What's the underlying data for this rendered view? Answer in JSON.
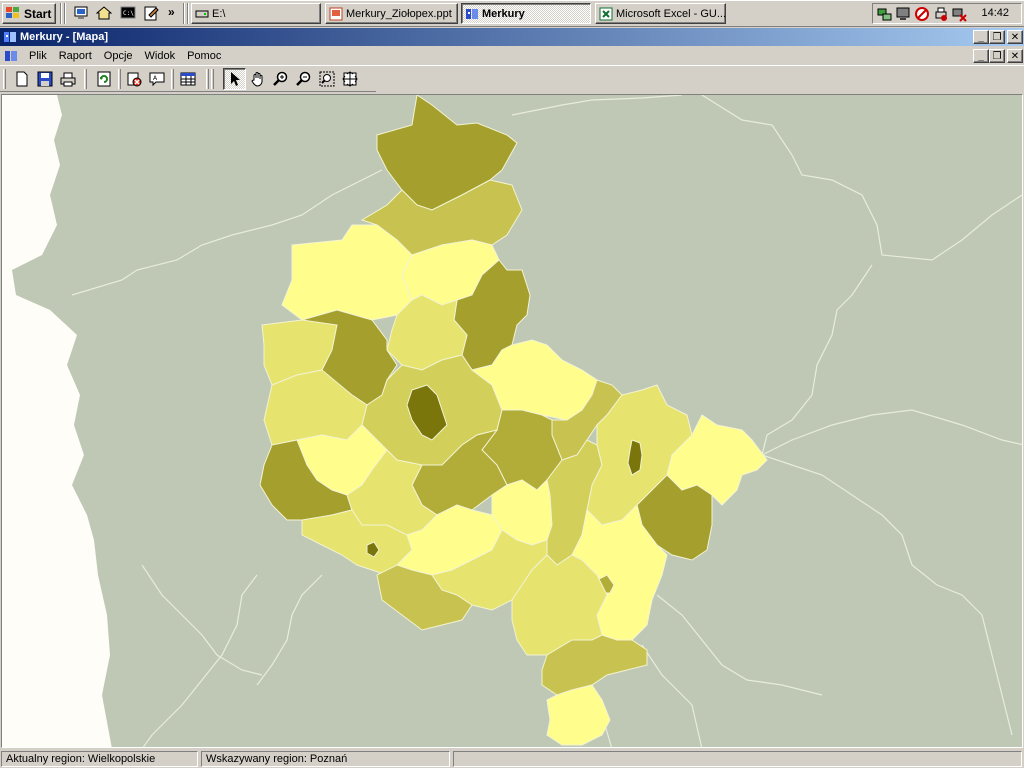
{
  "taskbar": {
    "start_label": "Start",
    "quick_launch": [
      "computer-icon",
      "home-icon",
      "terminal-icon",
      "notepad-icon"
    ],
    "more_label": "»",
    "tasks": [
      {
        "label": "E:\\",
        "icon": "folder-icon"
      },
      {
        "label": "Merkury_Ziołopex.ppt",
        "icon": "powerpoint-icon"
      },
      {
        "label": "Merkury",
        "icon": "map-app-icon",
        "active": true
      },
      {
        "label": "Microsoft Excel - GU...",
        "icon": "excel-icon"
      }
    ],
    "tray_icons": [
      "network-icon",
      "monitor-icon",
      "security-icon",
      "printer-icon",
      "disconnected-network-icon"
    ],
    "clock": "14:42"
  },
  "window": {
    "title": "Merkury - [Mapa]"
  },
  "menu": [
    "Plik",
    "Raport",
    "Opcje",
    "Widok",
    "Pomoc"
  ],
  "toolbar": {
    "groups": [
      [
        "new-document-icon",
        "save-icon",
        "print-icon"
      ],
      [
        "refresh-icon"
      ],
      [
        "legend-icon",
        "label-icon"
      ],
      [
        "table-icon"
      ],
      [
        "pointer-icon",
        "pan-hand-icon",
        "zoom-in-icon",
        "zoom-out-icon",
        "zoom-window-icon",
        "zoom-extent-icon"
      ]
    ]
  },
  "map": {
    "background_color": "#bfc8b4",
    "border_color": "#e8ecdc",
    "sea_color": "#fffdf7",
    "palette": [
      "#fffe8c",
      "#f2f08a",
      "#e6e36e",
      "#d2cf5a",
      "#c8c350",
      "#b2ad38",
      "#a5a02d",
      "#8e8a1c",
      "#7a760b"
    ]
  },
  "status": {
    "current_region": "Aktualny region: Wielkopolskie",
    "pointed_region": "Wskazywany region: Poznań"
  }
}
